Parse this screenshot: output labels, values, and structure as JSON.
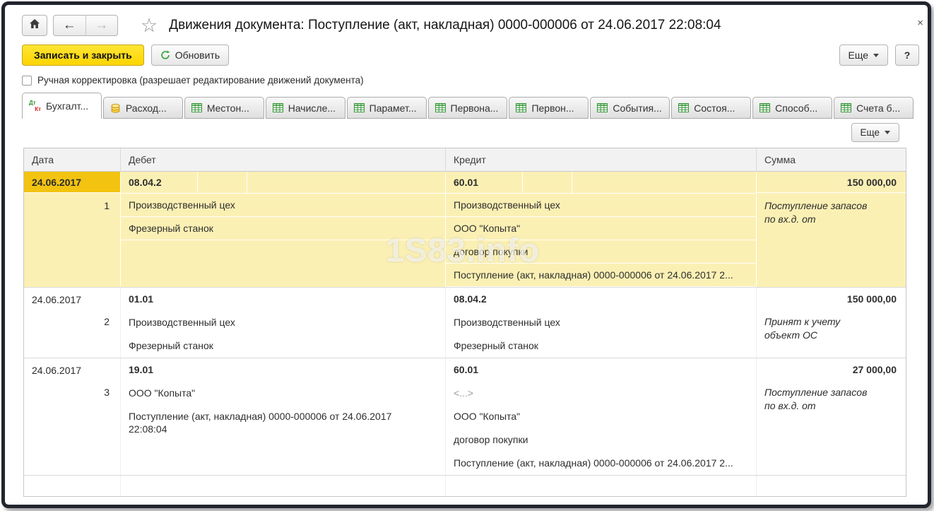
{
  "window": {
    "title": "Движения документа: Поступление (акт, накладная) 0000-000006 от 24.06.2017 22:08:04",
    "close": "×"
  },
  "toolbar": {
    "save_close_label": "Записать и закрыть",
    "refresh_label": "Обновить",
    "more_label": "Еще",
    "help_label": "?"
  },
  "manual_correction_label": "Ручная корректировка (разрешает редактирование движений документа)",
  "tabs": [
    {
      "label": "Бухгалт...",
      "icon": "dt-kt-icon",
      "active": true
    },
    {
      "label": "Расход...",
      "icon": "coins-icon",
      "active": false
    },
    {
      "label": "Местон...",
      "icon": "table-icon",
      "active": false
    },
    {
      "label": "Начисле...",
      "icon": "table-icon",
      "active": false
    },
    {
      "label": "Парамет...",
      "icon": "table-icon",
      "active": false
    },
    {
      "label": "Первона...",
      "icon": "table-icon",
      "active": false
    },
    {
      "label": "Первон...",
      "icon": "table-icon",
      "active": false
    },
    {
      "label": "События...",
      "icon": "table-icon",
      "active": false
    },
    {
      "label": "Состоя...",
      "icon": "table-icon",
      "active": false
    },
    {
      "label": "Способ...",
      "icon": "table-icon",
      "active": false
    },
    {
      "label": "Счета б...",
      "icon": "table-icon",
      "active": false
    }
  ],
  "panel": {
    "more_label": "Еще"
  },
  "table": {
    "headers": [
      "Дата",
      "Дебет",
      "Кредит",
      "Сумма"
    ],
    "rows": [
      {
        "date": "24.06.2017",
        "num": "1",
        "selected": true,
        "debit": {
          "account": "08.04.2",
          "details": [
            "Производственный цех",
            "Фрезерный станок"
          ]
        },
        "credit": {
          "account": "60.01",
          "details": [
            "Производственный цех",
            "ООО \"Копыта\"",
            "договор покупки",
            "Поступление (акт, накладная) 0000-000006 от 24.06.2017 2..."
          ]
        },
        "amount": "150 000,00",
        "comment": "Поступление запасов\nпо вх.д.  от"
      },
      {
        "date": "24.06.2017",
        "num": "2",
        "selected": false,
        "debit": {
          "account": "01.01",
          "details": [
            "Производственный цех",
            "Фрезерный станок"
          ]
        },
        "credit": {
          "account": "08.04.2",
          "details": [
            "Производственный цех",
            "Фрезерный станок"
          ]
        },
        "amount": "150 000,00",
        "comment": "Принят к учету\nобъект ОС"
      },
      {
        "date": "24.06.2017",
        "num": "3",
        "selected": false,
        "debit": {
          "account": "19.01",
          "details": [
            "ООО \"Копыта\"",
            "Поступление (акт, накладная) 0000-000006 от 24.06.2017\n22:08:04"
          ]
        },
        "credit": {
          "account": "60.01",
          "details": [
            "<...>",
            "ООО \"Копыта\"",
            "договор покупки",
            "Поступление (акт, накладная) 0000-000006 от 24.06.2017 2..."
          ]
        },
        "amount": "27 000,00",
        "comment": "Поступление запасов\nпо вх.д.  от"
      }
    ]
  },
  "watermark": "1S83.info",
  "colors": {
    "selected_date_cell": "#f2c411",
    "selected_row": "#fbf0b4",
    "primary_button": "#ffdd00",
    "window_frame": "#22252e"
  }
}
